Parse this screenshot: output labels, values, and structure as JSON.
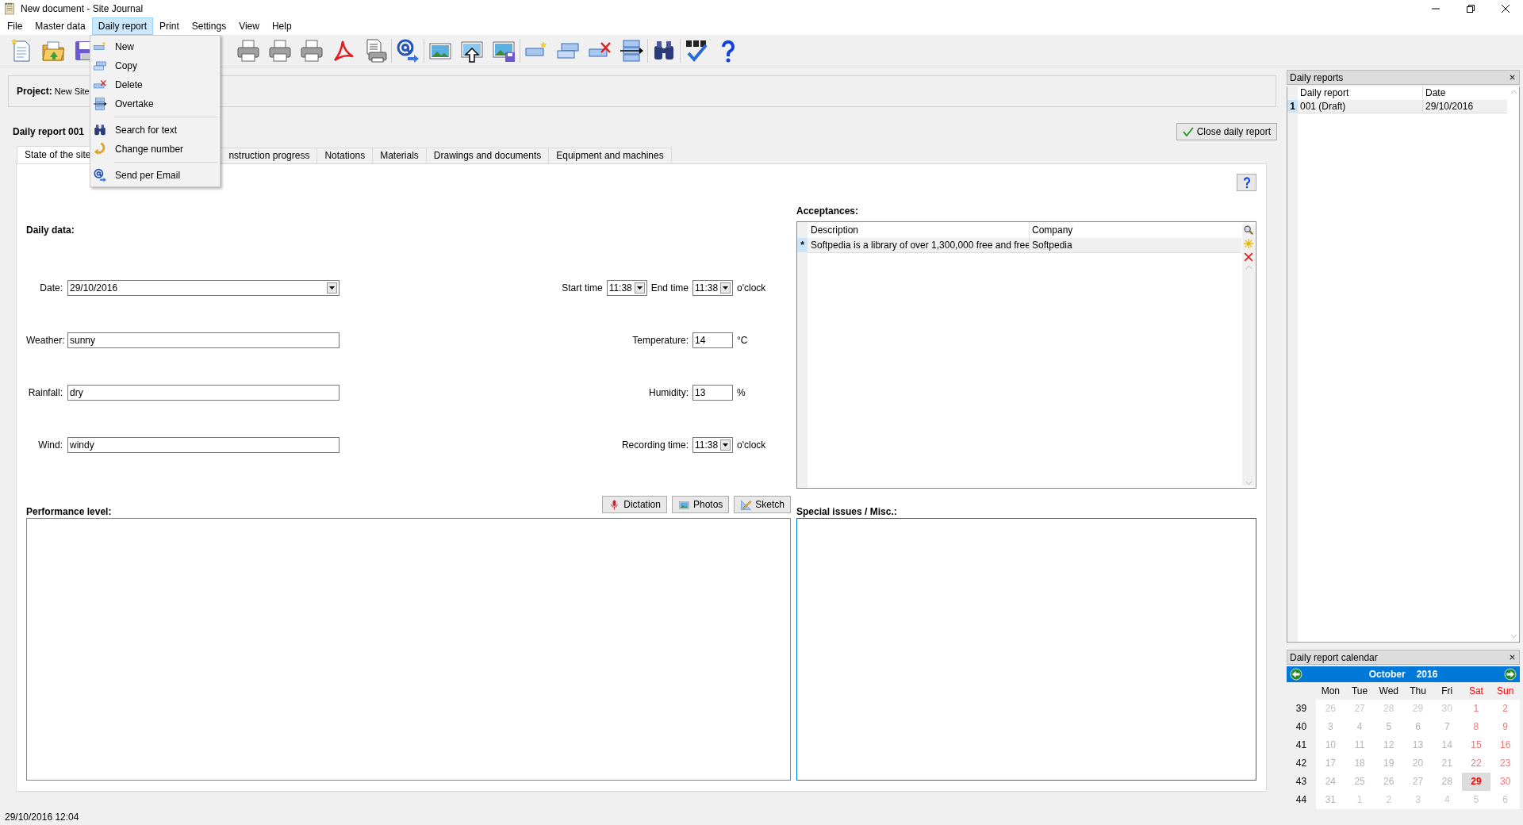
{
  "window": {
    "title": "New document - Site Journal"
  },
  "menu_bar": [
    {
      "label": "File",
      "selected": false
    },
    {
      "label": "Master data",
      "selected": false
    },
    {
      "label": "Daily report",
      "selected": true
    },
    {
      "label": "Print",
      "selected": false
    },
    {
      "label": "Settings",
      "selected": false
    },
    {
      "label": "View",
      "selected": false
    },
    {
      "label": "Help",
      "selected": false
    }
  ],
  "open_menu": [
    {
      "kind": "item",
      "label": "New"
    },
    {
      "kind": "item",
      "label": "Copy"
    },
    {
      "kind": "item",
      "label": "Delete"
    },
    {
      "kind": "item",
      "label": "Overtake"
    },
    {
      "kind": "separator"
    },
    {
      "kind": "item",
      "label": "Search for text"
    },
    {
      "kind": "item",
      "label": "Change number"
    },
    {
      "kind": "separator"
    },
    {
      "kind": "item",
      "label": "Send per Email"
    }
  ],
  "project": {
    "label": "Project:",
    "value": "New Site"
  },
  "report": {
    "title": "Daily report 001",
    "close_button": "Close daily report"
  },
  "tabs": [
    {
      "label": "State of the site",
      "selected": true
    },
    {
      "label": "nstruction progress",
      "selected": false
    },
    {
      "label": "Notations",
      "selected": false
    },
    {
      "label": "Materials",
      "selected": false
    },
    {
      "label": "Drawings and documents",
      "selected": false
    },
    {
      "label": "Equipment and machines",
      "selected": false
    }
  ],
  "daily_data": {
    "heading": "Daily data:",
    "rows": [
      {
        "left": {
          "label": "Date:",
          "value": "29/10/2016",
          "kind": "dropdown"
        },
        "right": [
          {
            "label": "Start time",
            "value": "11:38",
            "kind": "dropdown"
          },
          {
            "label": "End time",
            "value": "11:38",
            "kind": "dropdown"
          }
        ],
        "unit": "o'clock"
      },
      {
        "left": {
          "label": "Weather:",
          "value": "sunny",
          "kind": "text"
        },
        "right": [
          {
            "label": "Temperature:",
            "value": "14",
            "kind": "text"
          }
        ],
        "unit": "°C"
      },
      {
        "left": {
          "label": "Rainfall:",
          "value": "dry",
          "kind": "text"
        },
        "right": [
          {
            "label": "Humidity:",
            "value": "13",
            "kind": "text"
          }
        ],
        "unit": "%"
      },
      {
        "left": {
          "label": "Wind:",
          "value": "windy",
          "kind": "text"
        },
        "right": [
          {
            "label": "Recording time:",
            "value": "11:38",
            "kind": "dropdown"
          }
        ],
        "unit": "o'clock"
      }
    ]
  },
  "acceptances": {
    "heading": "Acceptances:",
    "columns": [
      "Description",
      "Company"
    ],
    "rows": [
      {
        "marker": "*",
        "cells": [
          "Softpedia is a library of over 1,300,000 free and free",
          "Softpedia"
        ],
        "selected": true
      }
    ]
  },
  "performance": {
    "heading": "Performance level:",
    "buttons": [
      {
        "label": "Dictation"
      },
      {
        "label": "Photos"
      },
      {
        "label": "Sketch"
      }
    ]
  },
  "special": {
    "heading": "Special issues / Misc.:",
    "focused": true
  },
  "status_bar": "29/10/2016 12:04",
  "daily_reports": {
    "title": "Daily reports",
    "columns": [
      "Daily report",
      "Date"
    ],
    "rows": [
      {
        "number": "1",
        "cells": [
          "001 (Draft)",
          "29/10/2016"
        ],
        "selected": true
      }
    ]
  },
  "calendar": {
    "title": "Daily report calendar",
    "month": "October",
    "year": "2016",
    "weekdays": [
      {
        "label": "Mon",
        "weekend": false
      },
      {
        "label": "Tue",
        "weekend": false
      },
      {
        "label": "Wed",
        "weekend": false
      },
      {
        "label": "Thu",
        "weekend": false
      },
      {
        "label": "Fri",
        "weekend": false
      },
      {
        "label": "Sat",
        "weekend": true
      },
      {
        "label": "Sun",
        "weekend": true
      }
    ],
    "weeks": [
      {
        "number": "39",
        "days": [
          {
            "day": "26",
            "outside": true,
            "weekend": false,
            "selected": false
          },
          {
            "day": "27",
            "outside": true,
            "weekend": false,
            "selected": false
          },
          {
            "day": "28",
            "outside": true,
            "weekend": false,
            "selected": false
          },
          {
            "day": "29",
            "outside": true,
            "weekend": false,
            "selected": false
          },
          {
            "day": "30",
            "outside": true,
            "weekend": false,
            "selected": false
          },
          {
            "day": "1",
            "outside": false,
            "weekend": true,
            "selected": false
          },
          {
            "day": "2",
            "outside": false,
            "weekend": true,
            "selected": false
          }
        ]
      },
      {
        "number": "40",
        "days": [
          {
            "day": "3",
            "outside": false,
            "weekend": false,
            "selected": false
          },
          {
            "day": "4",
            "outside": false,
            "weekend": false,
            "selected": false
          },
          {
            "day": "5",
            "outside": false,
            "weekend": false,
            "selected": false
          },
          {
            "day": "6",
            "outside": false,
            "weekend": false,
            "selected": false
          },
          {
            "day": "7",
            "outside": false,
            "weekend": false,
            "selected": false
          },
          {
            "day": "8",
            "outside": false,
            "weekend": true,
            "selected": false
          },
          {
            "day": "9",
            "outside": false,
            "weekend": true,
            "selected": false
          }
        ]
      },
      {
        "number": "41",
        "days": [
          {
            "day": "10",
            "outside": false,
            "weekend": false,
            "selected": false
          },
          {
            "day": "11",
            "outside": false,
            "weekend": false,
            "selected": false
          },
          {
            "day": "12",
            "outside": false,
            "weekend": false,
            "selected": false
          },
          {
            "day": "13",
            "outside": false,
            "weekend": false,
            "selected": false
          },
          {
            "day": "14",
            "outside": false,
            "weekend": false,
            "selected": false
          },
          {
            "day": "15",
            "outside": false,
            "weekend": true,
            "selected": false
          },
          {
            "day": "16",
            "outside": false,
            "weekend": true,
            "selected": false
          }
        ]
      },
      {
        "number": "42",
        "days": [
          {
            "day": "17",
            "outside": false,
            "weekend": false,
            "selected": false
          },
          {
            "day": "18",
            "outside": false,
            "weekend": false,
            "selected": false
          },
          {
            "day": "19",
            "outside": false,
            "weekend": false,
            "selected": false
          },
          {
            "day": "20",
            "outside": false,
            "weekend": false,
            "selected": false
          },
          {
            "day": "21",
            "outside": false,
            "weekend": false,
            "selected": false
          },
          {
            "day": "22",
            "outside": false,
            "weekend": true,
            "selected": false
          },
          {
            "day": "23",
            "outside": false,
            "weekend": true,
            "selected": false
          }
        ]
      },
      {
        "number": "43",
        "days": [
          {
            "day": "24",
            "outside": false,
            "weekend": false,
            "selected": false
          },
          {
            "day": "25",
            "outside": false,
            "weekend": false,
            "selected": false
          },
          {
            "day": "26",
            "outside": false,
            "weekend": false,
            "selected": false
          },
          {
            "day": "27",
            "outside": false,
            "weekend": false,
            "selected": false
          },
          {
            "day": "28",
            "outside": false,
            "weekend": false,
            "selected": false
          },
          {
            "day": "29",
            "outside": false,
            "weekend": true,
            "selected": true
          },
          {
            "day": "30",
            "outside": false,
            "weekend": true,
            "selected": false
          }
        ]
      },
      {
        "number": "44",
        "days": [
          {
            "day": "31",
            "outside": false,
            "weekend": false,
            "selected": false
          },
          {
            "day": "1",
            "outside": true,
            "weekend": false,
            "selected": false
          },
          {
            "day": "2",
            "outside": true,
            "weekend": false,
            "selected": false
          },
          {
            "day": "3",
            "outside": true,
            "weekend": false,
            "selected": false
          },
          {
            "day": "4",
            "outside": true,
            "weekend": false,
            "selected": false
          },
          {
            "day": "5",
            "outside": true,
            "weekend": true,
            "selected": false
          },
          {
            "day": "6",
            "outside": true,
            "weekend": true,
            "selected": false
          }
        ]
      }
    ]
  }
}
